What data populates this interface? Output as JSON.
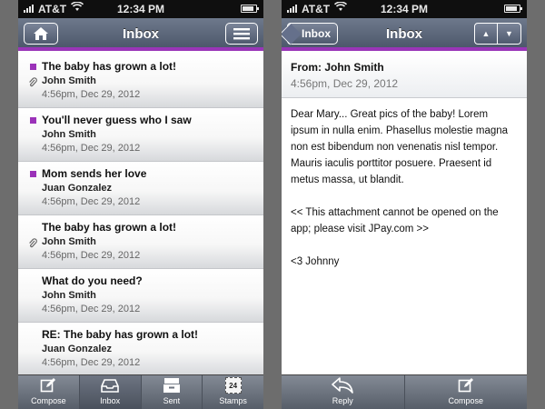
{
  "status": {
    "carrier": "AT&T",
    "time": "12:34 PM"
  },
  "inbox": {
    "title": "Inbox",
    "messages": [
      {
        "subject": "The baby has grown a lot!",
        "sender": "John Smith",
        "date": "4:56pm, Dec 29, 2012",
        "unread": true,
        "attachment": true
      },
      {
        "subject": "You'll never guess who I saw",
        "sender": "John Smith",
        "date": "4:56pm, Dec 29, 2012",
        "unread": true,
        "attachment": false
      },
      {
        "subject": "Mom sends her love",
        "sender": "Juan Gonzalez",
        "date": "4:56pm, Dec 29, 2012",
        "unread": true,
        "attachment": false
      },
      {
        "subject": "The baby has grown a lot!",
        "sender": "John Smith",
        "date": "4:56pm, Dec 29, 2012",
        "unread": false,
        "attachment": true
      },
      {
        "subject": "What do you need?",
        "sender": "John Smith",
        "date": "4:56pm, Dec 29, 2012",
        "unread": false,
        "attachment": false
      },
      {
        "subject": "RE: The baby has grown a lot!",
        "sender": "Juan Gonzalez",
        "date": "4:56pm, Dec 29, 2012",
        "unread": false,
        "attachment": false
      }
    ],
    "tabs": {
      "compose": "Compose",
      "inbox": "Inbox",
      "sent": "Sent",
      "stamps": "Stamps",
      "stamps_count": "24"
    }
  },
  "detail": {
    "title": "Inbox",
    "back_label": "Inbox",
    "from": "From: John Smith",
    "date": "4:56pm, Dec 29, 2012",
    "body_p1": "Dear Mary... Great pics of the baby! Lorem ipsum in nulla enim. Phasellus molestie magna non est bibendum non venenatis nisl tempor. Mauris iaculis porttitor posuere. Praesent id metus massa, ut blandit.",
    "body_p2": "<< This attachment cannot be opened on the app; please visit JPay.com >>",
    "body_p3": "<3 Johnny",
    "tabs": {
      "reply": "Reply",
      "compose": "Compose"
    }
  },
  "colors": {
    "accent": "#9b32b9",
    "navbar": "#5a6579",
    "tabbar": "#6b727d"
  }
}
